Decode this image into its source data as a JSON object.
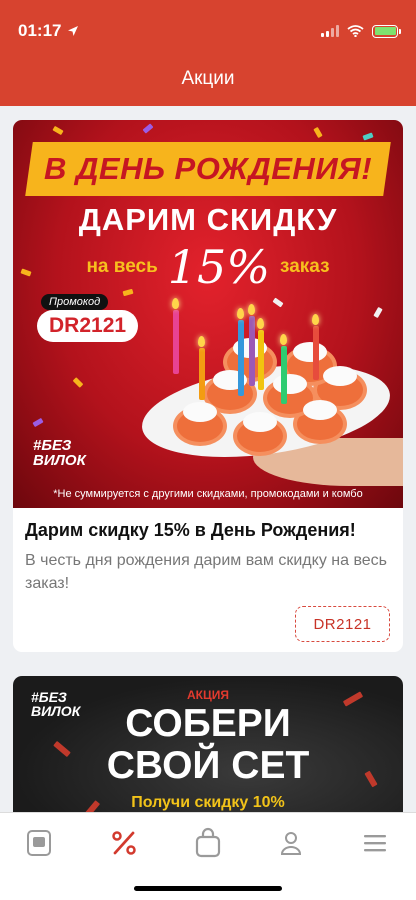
{
  "status_bar": {
    "time": "01:17"
  },
  "header": {
    "title": "Акции"
  },
  "promo_1": {
    "banner": {
      "headline": "В ДЕНЬ РОЖДЕНИЯ!",
      "subline": "ДАРИМ СКИДКУ",
      "line3_left": "на весь",
      "line3_percent": "15%",
      "line3_right": "заказ",
      "promo_label": "Промокод",
      "promo_code": "DR2121",
      "brand": [
        "#БЕЗ",
        "ВИЛОК"
      ],
      "disclaimer": "*Не суммируется с другими скидками, промокодами и комбо"
    },
    "title": "Дарим скидку 15% в День Рождения!",
    "description": "В честь дня рождения дарим вам скидку на весь заказ!",
    "code_button": "DR2121"
  },
  "promo_2": {
    "banner": {
      "brand": [
        "#БЕЗ",
        "ВИЛОК"
      ],
      "tag": "АКЦИЯ",
      "line1": "СОБЕРИ",
      "line2": "СВОЙ СЕТ",
      "line3": "Получи скидку 10%"
    }
  },
  "tab_bar": {
    "tabs": [
      {
        "icon": "menu-book-icon",
        "active": false
      },
      {
        "icon": "percent-icon",
        "active": true
      },
      {
        "icon": "shopping-bag-icon",
        "active": false
      },
      {
        "icon": "profile-icon",
        "active": false
      },
      {
        "icon": "hamburger-menu-icon",
        "active": false
      }
    ]
  },
  "colors": {
    "brand_red": "#d7432f",
    "tab_active": "#d23a2e",
    "tab_inactive": "#9a9a9a"
  }
}
